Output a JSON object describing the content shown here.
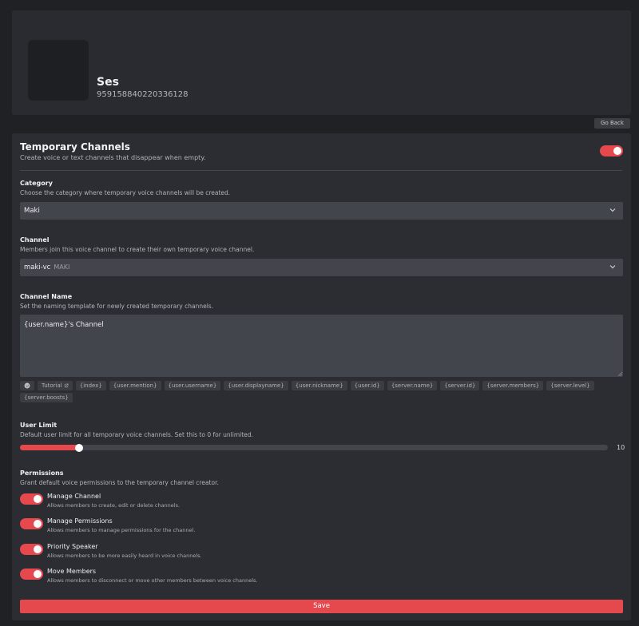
{
  "server": {
    "name": "Ses",
    "id": "959158840220336128"
  },
  "header": {
    "go_back_label": "Go Back"
  },
  "feature": {
    "title": "Temporary Channels",
    "subtitle": "Create voice or text channels that disappear when empty.",
    "enabled": true
  },
  "category": {
    "label": "Category",
    "description": "Choose the category where temporary voice channels will be created.",
    "selected": "Maki"
  },
  "channel": {
    "label": "Channel",
    "description": "Members join this voice channel to create their own temporary voice channel.",
    "selected": "maki-vc",
    "selected_category": "MAKI"
  },
  "channel_name": {
    "label": "Channel Name",
    "description": "Set the naming template for newly created temporary channels.",
    "value": "{user.name}'s Channel"
  },
  "variables": {
    "emoji_icon": "smiley-icon",
    "tutorial_label": "Tutorial",
    "items": [
      "{index}",
      "{user.mention}",
      "{user.username}",
      "{user.displayname}",
      "{user.nickname}",
      "{user.id}",
      "{server.name}",
      "{server.id}",
      "{server.members}",
      "{server.level}",
      "{server.boosts}"
    ]
  },
  "user_limit": {
    "label": "User Limit",
    "description": "Default user limit for all temporary voice channels. Set this to 0 for unlimited.",
    "value": 10,
    "min": 0,
    "max": 99
  },
  "permissions": {
    "label": "Permissions",
    "description": "Grant default voice permissions to the temporary channel creator.",
    "items": [
      {
        "title": "Manage Channel",
        "desc": "Allows members to create, edit or delete channels.",
        "enabled": true
      },
      {
        "title": "Manage Permissions",
        "desc": "Allows members to manage permissions for the channel.",
        "enabled": true
      },
      {
        "title": "Priority Speaker",
        "desc": "Allows members to be more easily heard in voice channels.",
        "enabled": true
      },
      {
        "title": "Move Members",
        "desc": "Allows members to disconnect or move other members between voice channels.",
        "enabled": true
      }
    ]
  },
  "save_label": "Save",
  "colors": {
    "accent": "#e5484d",
    "background": "#202125",
    "card": "#2c2d33",
    "input": "#43454c"
  }
}
